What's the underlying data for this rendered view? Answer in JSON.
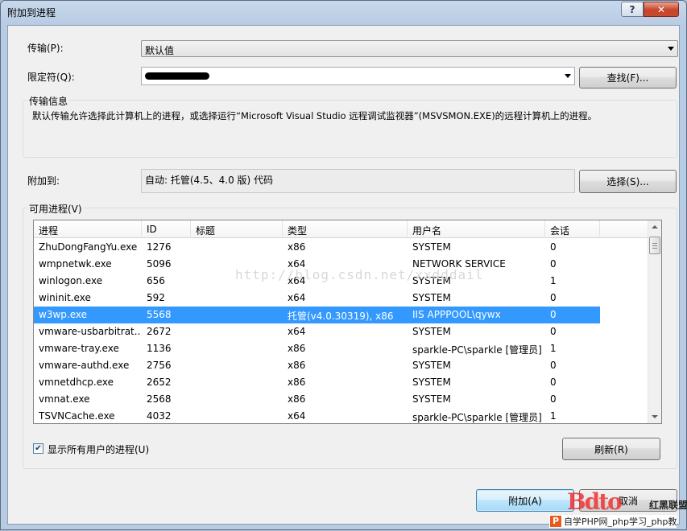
{
  "window": {
    "title": "附加到进程"
  },
  "transport": {
    "label": "传输(P):",
    "value": "默认值"
  },
  "qualifier": {
    "label": "限定符(Q):",
    "find_button": "查找(F)..."
  },
  "transport_info": {
    "title": "传输信息",
    "text": "默认传输允许选择此计算机上的进程，或选择运行“Microsoft Visual Studio 远程调试监视器”(MSVSMON.EXE)的远程计算机上的进程。"
  },
  "attach_to": {
    "label": "附加到:",
    "value": "自动: 托管(4.5、4.0 版) 代码",
    "select_button": "选择(S)..."
  },
  "processes": {
    "group_title": "可用进程(V)",
    "columns": [
      "进程",
      "ID",
      "标题",
      "类型",
      "用户名",
      "会话"
    ],
    "rows": [
      {
        "name": "ZhuDongFangYu.exe",
        "id": "1276",
        "title": "",
        "type": "x86",
        "user": "SYSTEM",
        "session": "0"
      },
      {
        "name": "wmpnetwk.exe",
        "id": "5096",
        "title": "",
        "type": "x64",
        "user": "NETWORK SERVICE",
        "session": "0"
      },
      {
        "name": "winlogon.exe",
        "id": "656",
        "title": "",
        "type": "x64",
        "user": "SYSTEM",
        "session": "1"
      },
      {
        "name": "wininit.exe",
        "id": "592",
        "title": "",
        "type": "x64",
        "user": "SYSTEM",
        "session": "0"
      },
      {
        "name": "w3wp.exe",
        "id": "5568",
        "title": "",
        "type": "托管(v4.0.30319), x86",
        "user": "IIS APPPOOL\\qywx",
        "session": "0"
      },
      {
        "name": "vmware-usbarbitrat...",
        "id": "2672",
        "title": "",
        "type": "x64",
        "user": "SYSTEM",
        "session": "0"
      },
      {
        "name": "vmware-tray.exe",
        "id": "1136",
        "title": "",
        "type": "x86",
        "user": "sparkle-PC\\sparkle [管理员]",
        "session": "1"
      },
      {
        "name": "vmware-authd.exe",
        "id": "2756",
        "title": "",
        "type": "x86",
        "user": "SYSTEM",
        "session": "0"
      },
      {
        "name": "vmnetdhcp.exe",
        "id": "2652",
        "title": "",
        "type": "x86",
        "user": "SYSTEM",
        "session": "0"
      },
      {
        "name": "vmnat.exe",
        "id": "2568",
        "title": "",
        "type": "x86",
        "user": "SYSTEM",
        "session": "0"
      },
      {
        "name": "TSVNCache.exe",
        "id": "4032",
        "title": "",
        "type": "x64",
        "user": "sparkle-PC\\sparkle [管理员]",
        "session": "1"
      }
    ],
    "selected_row": "w3wp.exe"
  },
  "show_all": {
    "label": "显示所有用户的进程(U)",
    "checked": true
  },
  "refresh_button": "刷新(R)",
  "attach_button": "附加(A)",
  "cancel_button": "取消",
  "watermark": "http://blog.csdn.net/xxdddail",
  "logo": {
    "big": "Bdto",
    "side": "红黑联盟",
    "footer": "自学PHP网_php学习_php教"
  }
}
